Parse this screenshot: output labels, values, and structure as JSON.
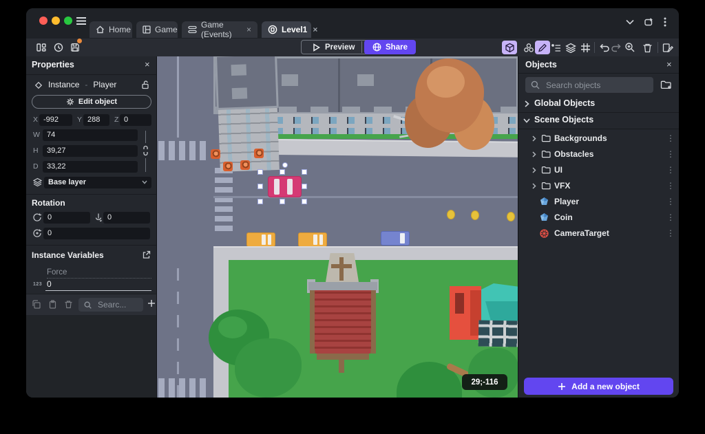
{
  "ui": {
    "close": "×",
    "kebab": "⋮"
  },
  "tabs": [
    {
      "label": "Home"
    },
    {
      "label": "Game"
    },
    {
      "label": "Game (Events)"
    },
    {
      "label": "Level1"
    }
  ],
  "toolbar": {
    "preview": "Preview",
    "share": "Share"
  },
  "properties": {
    "title": "Properties",
    "instance_label": "Instance",
    "separator": "-",
    "instance_name": "Player",
    "edit_object": "Edit object",
    "x_label": "X",
    "x_value": "-992",
    "y_label": "Y",
    "y_value": "288",
    "z_label": "Z",
    "z_value": "0",
    "w_label": "W",
    "w_value": "74",
    "h_label": "H",
    "h_value": "39,27",
    "d_label": "D",
    "d_value": "33,22",
    "layer_value": "Base layer",
    "rotation_title": "Rotation",
    "rot_x": "0",
    "rot_y": "0",
    "rot_z": "0",
    "variables_title": "Instance Variables",
    "variable_name": "Force",
    "variable_type": "123",
    "variable_value": "0",
    "search_placeholder": "Searc..."
  },
  "scene": {
    "badge": "29;-116"
  },
  "objects": {
    "title": "Objects",
    "search_placeholder": "Search objects",
    "global_section": "Global Objects",
    "scene_section": "Scene Objects",
    "folders": [
      {
        "name": "Backgrounds"
      },
      {
        "name": "Obstacles"
      },
      {
        "name": "UI"
      },
      {
        "name": "VFX"
      }
    ],
    "items": [
      {
        "name": "Player"
      },
      {
        "name": "Coin"
      },
      {
        "name": "CameraTarget"
      }
    ],
    "add_button": "Add a new object"
  },
  "colors": {
    "accent": "#6246f0",
    "toolbar_active_chip": "#c7b3f8",
    "road": "#6e7387",
    "grass": "#46a44b",
    "player_car": "#d53a74",
    "selection_handle": "#ffffff",
    "unsaved_dot": "#e98a3c"
  },
  "icons": [
    "hamburger-icon",
    "home-icon",
    "game-icon",
    "events-icon",
    "scene-icon",
    "panels-icon",
    "history-icon",
    "save-icon",
    "play-icon",
    "chevron-down-icon",
    "globe-icon",
    "cube-3d-icon",
    "object-group-icon",
    "pencil-icon",
    "instances-list-icon",
    "layers-icon",
    "grid-icon",
    "undo-icon",
    "redo-icon",
    "zoom-in-icon",
    "trash-icon",
    "scene-properties-icon",
    "diamond-icon",
    "lock-open-icon",
    "gear-icon",
    "link-icon",
    "rotate-x-icon",
    "rotate-y-icon",
    "rotate-z-icon",
    "external-link-icon",
    "copy-icon",
    "paste-icon",
    "search-icon",
    "plus-icon",
    "folder-icon",
    "folder-add-icon",
    "chevron-right-icon",
    "object-3d-icon",
    "camera-target-icon"
  ]
}
